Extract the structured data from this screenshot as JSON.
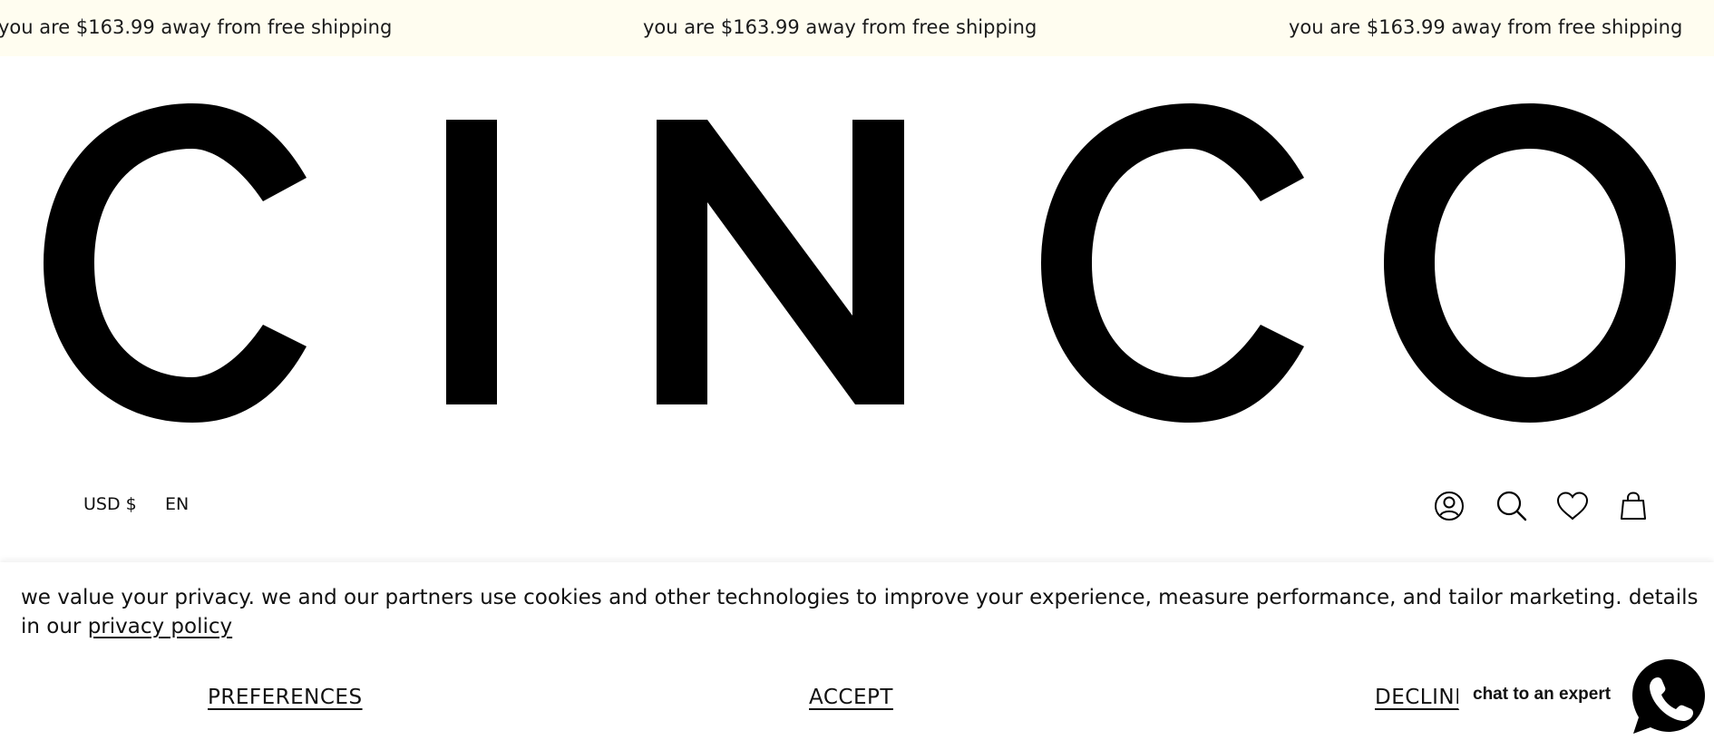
{
  "announcement": {
    "messages": [
      "you are $163.99 away from free shipping",
      "you are $163.99 away from free shipping",
      "you are $163.99 away from free shipping"
    ]
  },
  "brand": {
    "logo_text": "CINCO"
  },
  "header": {
    "currency": "USD $",
    "language": "EN",
    "icons": [
      "account-icon",
      "search-icon",
      "heart-icon",
      "cart-icon"
    ]
  },
  "cookie_banner": {
    "text": "we value your privacy. we and our partners use cookies and other technologies to improve your experience, measure performance, and tailor marketing. details in our ",
    "link_text": "privacy policy",
    "buttons": {
      "preferences": "PREFERENCES",
      "accept": "ACCEPT",
      "decline": "DECLINE"
    }
  },
  "chat": {
    "label": "chat to an expert",
    "icon": "whatsapp-phone-icon",
    "color": "#000000"
  },
  "colors": {
    "announcement_bg": "#fffdf0",
    "text": "#000000"
  }
}
